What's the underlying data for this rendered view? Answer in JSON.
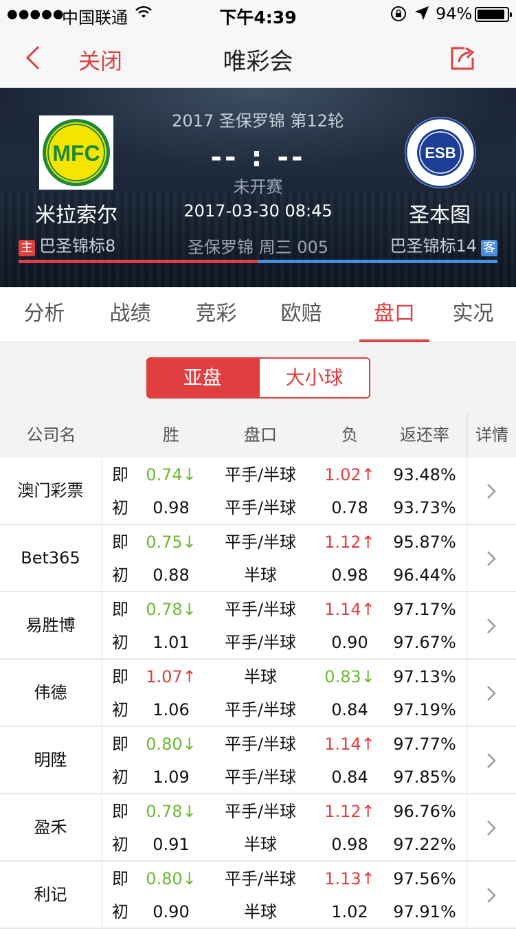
{
  "status_bar": {
    "signal_dots": "●●●●●",
    "carrier": "中国联通",
    "time": "下午4:39",
    "battery": "94%",
    "battery_level": 0.94
  },
  "nav": {
    "close_label": "关闭",
    "title": "唯彩会"
  },
  "match": {
    "league_round": "2017 圣保罗锦 第12轮",
    "score": "-- : --",
    "status": "未开赛",
    "datetime": "2017-03-30 08:45",
    "info": "圣保罗锦 周三 005",
    "home": {
      "name": "米拉索尔",
      "tag": "主",
      "rank": "巴圣锦标8",
      "logo_text": "MFC"
    },
    "away": {
      "name": "圣本图",
      "tag": "客",
      "rank": "巴圣锦标14",
      "logo_text": "ESB"
    },
    "colors": {
      "home": "#e03e3f",
      "away": "#4a90e2"
    }
  },
  "tabs": [
    "分析",
    "战绩",
    "竞彩",
    "欧赔",
    "盘口",
    "实况"
  ],
  "active_tab": "盘口",
  "segments": {
    "on": "亚盘",
    "off": "大小球"
  },
  "table": {
    "headers": {
      "company": "公司名",
      "win": "胜",
      "pankou": "盘口",
      "lose": "负",
      "return": "返还率",
      "detail": "详情"
    },
    "labels": {
      "now": "即",
      "init": "初"
    },
    "rows": [
      {
        "company": "澳门彩票",
        "now": {
          "win": "0.74↓",
          "win_dir": "down",
          "pankou": "平手/半球",
          "lose": "1.02↑",
          "lose_dir": "up",
          "ret": "93.48%"
        },
        "init": {
          "win": "0.98",
          "pankou": "平手/半球",
          "lose": "0.78",
          "ret": "93.73%"
        }
      },
      {
        "company": "Bet365",
        "now": {
          "win": "0.75↓",
          "win_dir": "down",
          "pankou": "平手/半球",
          "lose": "1.12↑",
          "lose_dir": "up",
          "ret": "95.87%"
        },
        "init": {
          "win": "0.88",
          "pankou": "半球",
          "lose": "0.98",
          "ret": "96.44%"
        }
      },
      {
        "company": "易胜博",
        "now": {
          "win": "0.78↓",
          "win_dir": "down",
          "pankou": "平手/半球",
          "lose": "1.14↑",
          "lose_dir": "up",
          "ret": "97.17%"
        },
        "init": {
          "win": "1.01",
          "pankou": "平手/半球",
          "lose": "0.90",
          "ret": "97.67%"
        }
      },
      {
        "company": "伟德",
        "now": {
          "win": "1.07↑",
          "win_dir": "up",
          "pankou": "半球",
          "lose": "0.83↓",
          "lose_dir": "down",
          "ret": "97.13%"
        },
        "init": {
          "win": "1.06",
          "pankou": "平手/半球",
          "lose": "0.84",
          "ret": "97.19%"
        }
      },
      {
        "company": "明陞",
        "now": {
          "win": "0.80↓",
          "win_dir": "down",
          "pankou": "平手/半球",
          "lose": "1.14↑",
          "lose_dir": "up",
          "ret": "97.77%"
        },
        "init": {
          "win": "1.09",
          "pankou": "平手/半球",
          "lose": "0.84",
          "ret": "97.85%"
        }
      },
      {
        "company": "盈禾",
        "now": {
          "win": "0.78↓",
          "win_dir": "down",
          "pankou": "平手/半球",
          "lose": "1.12↑",
          "lose_dir": "up",
          "ret": "96.76%"
        },
        "init": {
          "win": "0.91",
          "pankou": "半球",
          "lose": "0.98",
          "ret": "97.22%"
        }
      },
      {
        "company": "利记",
        "now": {
          "win": "0.80↓",
          "win_dir": "down",
          "pankou": "平手/半球",
          "lose": "1.13↑",
          "lose_dir": "up",
          "ret": "97.56%"
        },
        "init": {
          "win": "0.90",
          "pankou": "半球",
          "lose": "1.02",
          "ret": "97.91%"
        }
      }
    ]
  },
  "colors": {
    "accent": "#e03e3f",
    "green": "#6ab831",
    "text": "#111111",
    "muted": "#555555",
    "bg": "#f3f3f3"
  }
}
